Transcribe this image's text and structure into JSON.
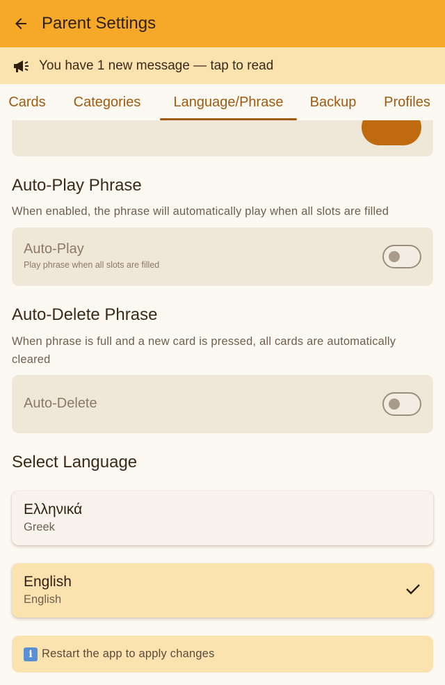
{
  "appbar": {
    "title": "Parent Settings",
    "back_icon": "arrow-left-icon"
  },
  "banner": {
    "icon": "megaphone-icon",
    "message": "You have 1 new message — tap to read"
  },
  "tabs": [
    {
      "label": "Cards",
      "active": false
    },
    {
      "label": "Categories",
      "active": false
    },
    {
      "label": "Language/Phrase",
      "active": true
    },
    {
      "label": "Backup",
      "active": false
    },
    {
      "label": "Profiles",
      "active": false
    }
  ],
  "auto_play": {
    "title": "Auto-Play Phrase",
    "description": "When enabled, the phrase will automatically play when all slots are filled",
    "label": "Auto-Play",
    "sublabel": "Play phrase when all slots are filled",
    "enabled": false
  },
  "auto_delete": {
    "title": "Auto-Delete Phrase",
    "description": "When phrase is full and a new card is pressed, all cards are automatically cleared",
    "label": "Auto-Delete",
    "enabled": false
  },
  "language": {
    "title": "Select Language",
    "options": [
      {
        "name": "Ελληνικά",
        "subtitle": "Greek",
        "selected": false
      },
      {
        "name": "English",
        "subtitle": "English",
        "selected": true
      }
    ]
  },
  "info": {
    "icon": "info-icon",
    "text": "Restart the app to apply changes"
  },
  "colors": {
    "appbar": "#f6a828",
    "banner": "#fbe3b0",
    "accent": "#a05a10",
    "background": "#fcf8f2"
  }
}
